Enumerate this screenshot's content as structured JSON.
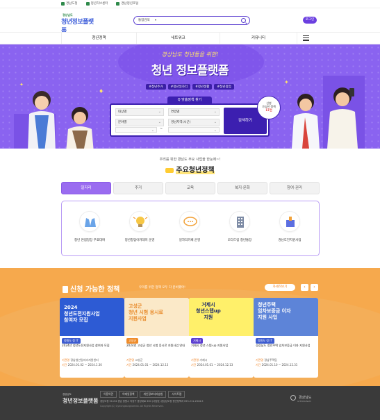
{
  "util_bar": {
    "links": [
      "경남도청",
      "청년허브센터",
      "경남청년포털"
    ]
  },
  "header": {
    "logo_top": "경상남도",
    "logo_main": "청년정보플랫폼",
    "search_scope": "통합검색",
    "search_placeholder": "",
    "login_label": "로그인"
  },
  "nav": {
    "items": [
      "청년정책",
      "네트워크",
      "커뮤니티"
    ]
  },
  "hero": {
    "subtitle": "경상남도 청년들을 위한!",
    "title": "청년 정보플랫폼",
    "tags": [
      "#청년주거",
      "#청년일자리",
      "#청년생활",
      "#청년창업"
    ],
    "finder_title": "Q 맞춤정책 찾기",
    "selects": [
      "대상별",
      "연령별",
      "분야별",
      "경남지역(시군)"
    ],
    "tilde": "~",
    "search_button": "검색하기",
    "badge_line1": "신청",
    "badge_line2": "가능한 정책",
    "badge_count": "17건"
  },
  "policy": {
    "kicker": "우리를 위한 경남도 주요 사업을 한눈에~!",
    "title": "주요청년정책",
    "tabs": [
      "일자리",
      "주거",
      "교육",
      "복지·문화",
      "참여·권리"
    ],
    "active_tab": 0,
    "items": [
      {
        "label": "청년 면접정장 무료대여",
        "icon": "suit-icon"
      },
      {
        "label": "청년창업아카데미 운영",
        "icon": "lightbulb-icon"
      },
      {
        "label": "일자리카페 운영",
        "icon": "chat-icon"
      },
      {
        "label": "모다드림 청년통장",
        "icon": "building-icon"
      },
      {
        "label": "경남도전지원사업",
        "icon": "box-icon"
      }
    ]
  },
  "apply": {
    "title": "신청 가능한 정책",
    "subtitle": "우리를 위한 정책 모두 다 준비했어!",
    "more_label": "자세히보기",
    "prev_arrow": "‹",
    "next_arrow": "›",
    "cards": [
      {
        "img_title": "2024\n청년도전지원사업\n참여자 모집",
        "tag": "정원도 청 IT",
        "name": "2024년 청년도전지원사업 참여자 모집",
        "org_label": "기관명",
        "org": "경남청년일자리지원센터",
        "period_label": "기간",
        "period": "2024.01.02 ~ 2024.1.30"
      },
      {
        "img_title": "고성군\n청년 시험 응시료\n지원사업",
        "tag": "고성군",
        "name": "2024년 고성군 청년 시험 응시료 지원사업 안내",
        "org_label": "기관명",
        "org": "고성군",
        "period_label": "기간",
        "period": "2024.01.01 ~ 2024.12.13"
      },
      {
        "img_title": "거제시\n청년스텝up\n지원",
        "tag": "거제시",
        "name": "거제시 청년 스텝-up 지원사업",
        "org_label": "기관명",
        "org": "거제시",
        "period_label": "기간",
        "period": "2024.01.01 ~ 2024.12.13"
      },
      {
        "img_title": "청년주택\n임차보증금 이자\n지원 사업",
        "tag": "정원도 청 IT",
        "name": "경상남도 청년주택 임차보증금 이자 지원사업",
        "org_label": "기관명",
        "org": "경남주택팀",
        "period_label": "기간",
        "period": "2024.01.10 ~ 2024.12.31"
      }
    ]
  },
  "footer": {
    "logo": "청년정보플랫폼",
    "logo_top": "경상남도",
    "links": [
      "이용약관",
      "이메일정책",
      "개인정보처리방침",
      "사이트맵"
    ],
    "address": "경남도청 51154 경남 창원시 의창구 중앙대로 300 (사림동) 경상남도청 청년정책과 055-211-2644-5",
    "copyright": "Copyright(C) Gyeongsangnamdo. All Rights Reserved.",
    "gov_name": "경상남도",
    "gov_en": "GYEONGNAM"
  },
  "colors": {
    "brand_purple": "#6b3fe0",
    "hero_bg": "#8a63f0",
    "apply_bg": "#f6a94d",
    "footer_bg": "#3a3a3a"
  }
}
